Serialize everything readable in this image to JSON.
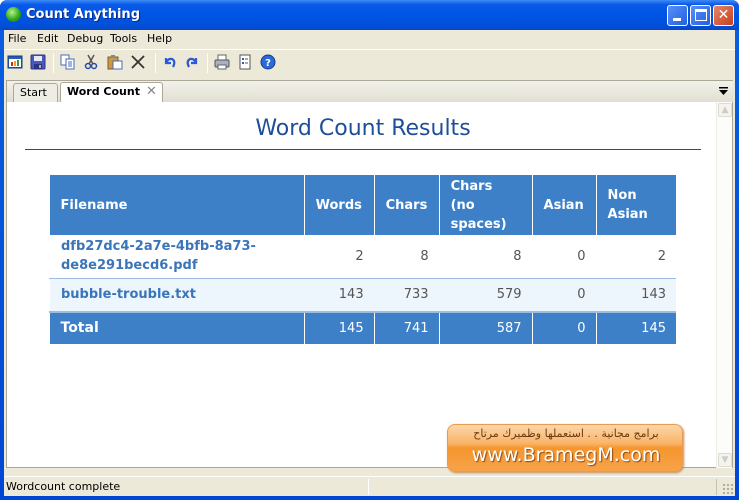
{
  "window": {
    "title": "Count Anything",
    "icon": "globe-app-icon",
    "controls": [
      "minimize",
      "maximize",
      "close"
    ]
  },
  "menubar": {
    "items": [
      {
        "label": "File"
      },
      {
        "label": "Edit"
      },
      {
        "label": "Debug"
      },
      {
        "label": "Tools"
      },
      {
        "label": "Help"
      }
    ]
  },
  "toolbar": {
    "buttons": [
      {
        "icon": "new-window-icon"
      },
      {
        "icon": "save-icon"
      },
      {
        "icon": "copy-icon"
      },
      {
        "icon": "cut-icon"
      },
      {
        "icon": "paste-icon"
      },
      {
        "icon": "delete-icon"
      },
      {
        "icon": "undo-icon"
      },
      {
        "icon": "redo-icon"
      },
      {
        "icon": "print-icon"
      },
      {
        "icon": "properties-icon"
      },
      {
        "icon": "help-icon"
      }
    ]
  },
  "tabs": [
    {
      "label": "Start",
      "active": false
    },
    {
      "label": "Word Count",
      "active": true,
      "close_glyph": "✕"
    }
  ],
  "main": {
    "heading": "Word Count Results",
    "table": {
      "columns": [
        "Filename",
        "Words",
        "Chars",
        "Chars (no spaces)",
        "Asian",
        "Non Asian"
      ],
      "header_lines": [
        [
          "Filename"
        ],
        [
          "Words"
        ],
        [
          "Chars"
        ],
        [
          "Chars",
          "(no",
          "spaces)"
        ],
        [
          "Asian"
        ],
        [
          "Non",
          "Asian"
        ]
      ],
      "rows": [
        {
          "filename_lines": [
            "dfb27dc4-2a7e-4bfb-8a73-",
            "de8e291becd6.pdf"
          ],
          "words": "2",
          "chars": "8",
          "chars_no_spaces": "8",
          "asian": "0",
          "non_asian": "2"
        },
        {
          "filename_lines": [
            "bubble-trouble.txt"
          ],
          "words": "143",
          "chars": "733",
          "chars_no_spaces": "579",
          "asian": "0",
          "non_asian": "143"
        }
      ],
      "total": {
        "label": "Total",
        "words": "145",
        "chars": "741",
        "chars_no_spaces": "587",
        "asian": "0",
        "non_asian": "145"
      }
    },
    "banner": {
      "tagline": "برامج مجانية . . استعملها وظميرك مرتاح",
      "url": "www.BramegM.com"
    }
  },
  "statusbar": {
    "text": "Wordcount complete"
  },
  "colors": {
    "header_blue": "#3d80c8",
    "heading_blue": "#1e4e9a",
    "link_blue": "#3b75b9",
    "alt_row": "#eef6fd"
  }
}
